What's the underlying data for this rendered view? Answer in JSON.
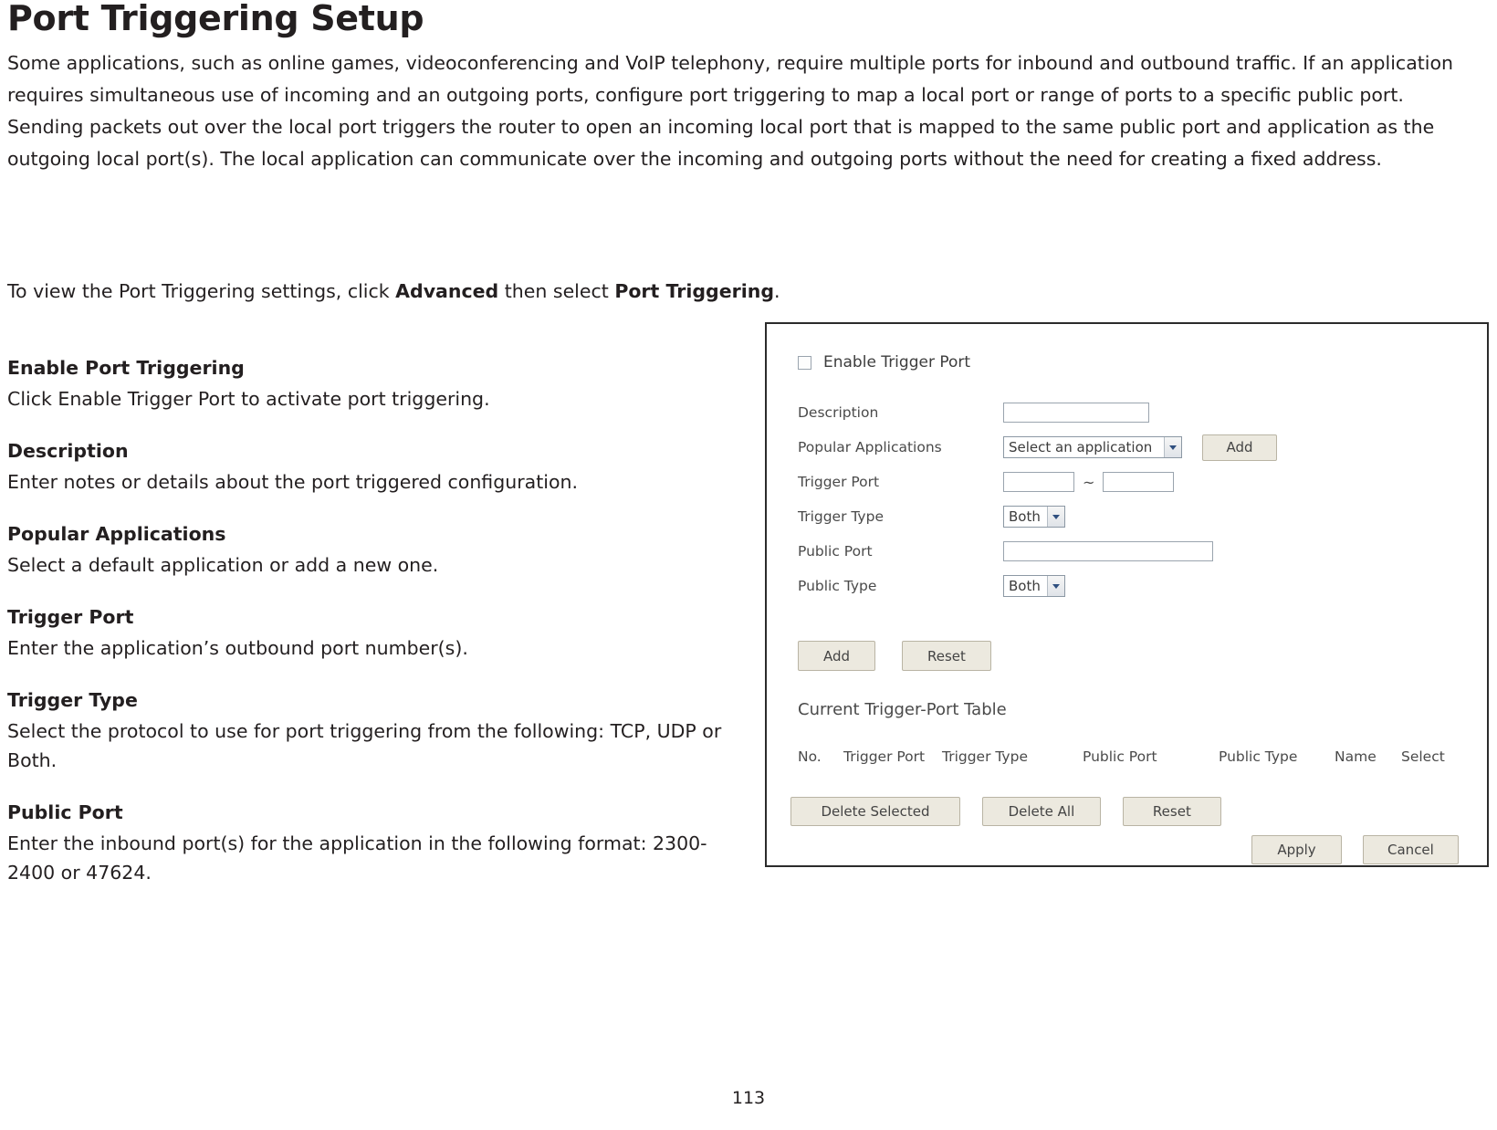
{
  "document": {
    "title": "Port Triggering Setup",
    "intro_paragraph": "Some applications, such as online games, videoconferencing and VoIP telephony, require multiple ports for inbound and outbound traffic. If an application requires simultaneous use of incoming and an outgoing ports, configure port triggering to map a local port or range of ports to a specific public port. Sending packets out over the local port triggers the router to open an incoming local port that is mapped to the same public port and application as the outgoing local port(s). The local application can communicate over the incoming and outgoing ports without the need for creating a fixed address.",
    "view_line": {
      "prefix": "To view the Port Triggering settings, click ",
      "bold1": "Advanced",
      "middle": " then select ",
      "bold2": "Port Triggering",
      "suffix": "."
    },
    "page_number": "113"
  },
  "sections": [
    {
      "heading": "Enable Port Triggering",
      "body": "Click Enable Trigger Port to activate port triggering."
    },
    {
      "heading": "Description",
      "body": "Enter notes or details about the port triggered configuration."
    },
    {
      "heading": "Popular Applications",
      "body": "Select a default application or add a new one."
    },
    {
      "heading": "Trigger Port",
      "body": "Enter the application’s outbound port number(s)."
    },
    {
      "heading": "Trigger Type",
      "body": "Select the protocol to use for port triggering from the following: TCP, UDP or Both."
    },
    {
      "heading": "Public Port",
      "body": "Enter the inbound port(s) for the application in the following format: 2300-2400 or 47624."
    }
  ],
  "screenshot": {
    "enable_checkbox_label": "Enable Trigger Port",
    "fields": [
      {
        "label": "Description",
        "value": "",
        "placeholder": ""
      },
      {
        "label": "Popular Applications",
        "value": "Select an application",
        "add_button": "Add"
      },
      {
        "label": "Trigger Port",
        "value_from": "",
        "separator": "~",
        "value_to": ""
      },
      {
        "label": "Trigger Type",
        "value": "Both"
      },
      {
        "label": "Public Port",
        "value": ""
      },
      {
        "label": "Public Type",
        "value": "Both"
      }
    ],
    "form_buttons": {
      "add": "Add",
      "reset": "Reset"
    },
    "table": {
      "title": "Current Trigger-Port Table",
      "columns": [
        "No.",
        "Trigger Port",
        "Trigger Type",
        "Public Port",
        "Public Type",
        "Name",
        "Select"
      ],
      "rows": []
    },
    "table_buttons": {
      "delete_selected": "Delete Selected",
      "delete_all": "Delete All",
      "reset": "Reset"
    },
    "footer_buttons": {
      "apply": "Apply",
      "cancel": "Cancel"
    }
  }
}
